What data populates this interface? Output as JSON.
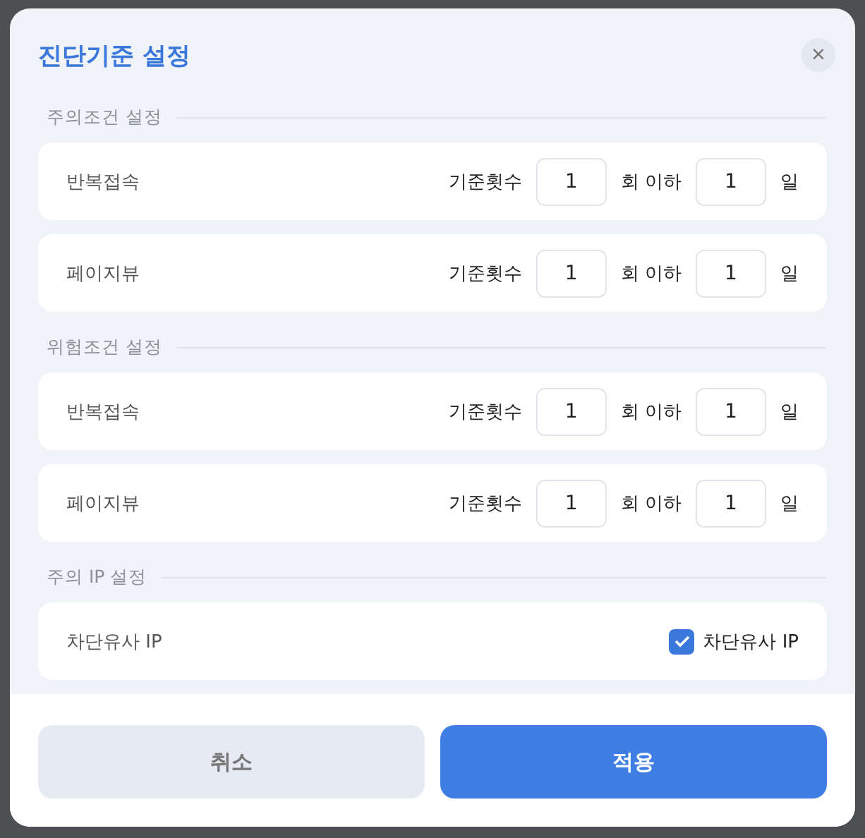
{
  "dialog": {
    "title": "진단기준 설정",
    "close_label": "×"
  },
  "sections": [
    {
      "heading": "주의조건 설정",
      "rows": [
        {
          "kind": "threshold",
          "label": "반복접속",
          "count_label": "기준횟수",
          "count": "1",
          "times_label": "회 이하",
          "days": "1",
          "days_label": "일"
        },
        {
          "kind": "threshold",
          "label": "페이지뷰",
          "count_label": "기준횟수",
          "count": "1",
          "times_label": "회 이하",
          "days": "1",
          "days_label": "일"
        }
      ]
    },
    {
      "heading": "위험조건 설정",
      "rows": [
        {
          "kind": "threshold",
          "label": "반복접속",
          "count_label": "기준횟수",
          "count": "1",
          "times_label": "회 이하",
          "days": "1",
          "days_label": "일"
        },
        {
          "kind": "threshold",
          "label": "페이지뷰",
          "count_label": "기준횟수",
          "count": "1",
          "times_label": "회 이하",
          "days": "1",
          "days_label": "일"
        }
      ]
    },
    {
      "heading": "주의 IP 설정",
      "rows": [
        {
          "kind": "checkbox",
          "label": "차단유사 IP",
          "checkbox_label": "차단유사 IP",
          "checked": true
        }
      ]
    }
  ],
  "buttons": [
    {
      "kind": "secondary",
      "label": "취소"
    },
    {
      "kind": "primary",
      "label": "적용"
    }
  ]
}
